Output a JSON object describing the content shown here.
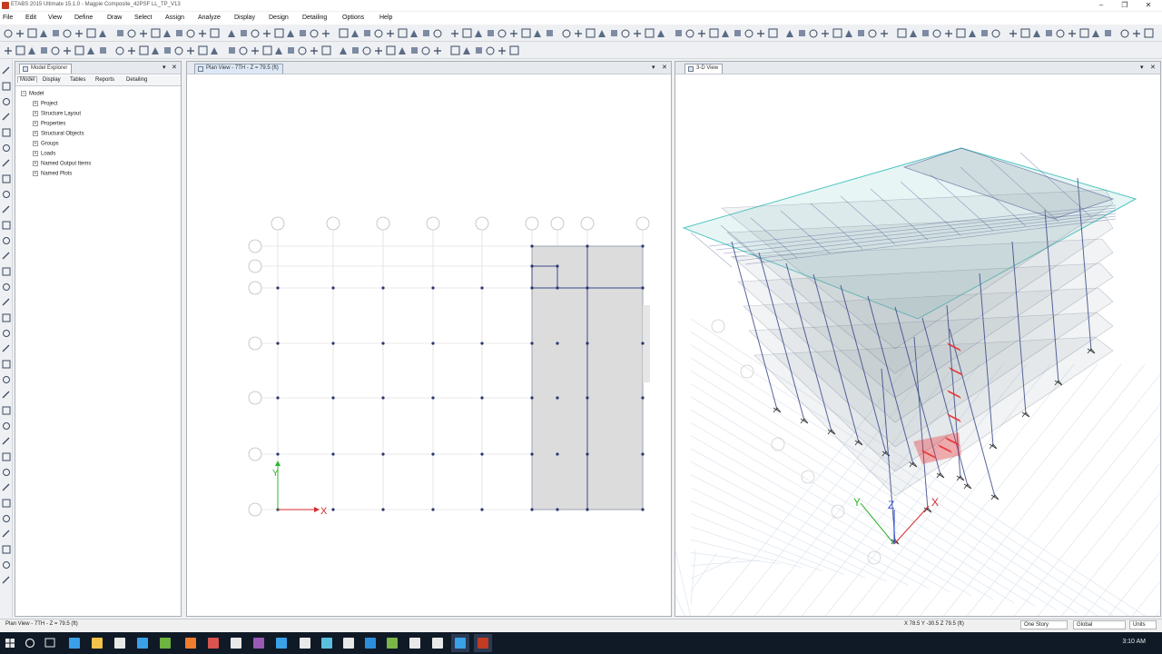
{
  "window": {
    "title": "ETABS 2015 Ultimate 15.1.0 - Magpie Composite_42PSF LL_TP_V13"
  },
  "menu": [
    "File",
    "Edit",
    "View",
    "Define",
    "Draw",
    "Select",
    "Assign",
    "Analyze",
    "Display",
    "Design",
    "Detailing",
    "Options",
    "Help"
  ],
  "model_explorer": {
    "title": "Model Explorer",
    "tabs": [
      "Model",
      "Display",
      "Tables",
      "Reports",
      "Detailing"
    ],
    "active_tab": "Model",
    "root": "Model",
    "items": [
      "Project",
      "Structure Layout",
      "Properties",
      "Structural Objects",
      "Groups",
      "Loads",
      "Named Output Items",
      "Named Plots"
    ]
  },
  "plan_view": {
    "title": "Plan View - 7TH - Z = 79.5 (ft)",
    "axis_x": "X",
    "axis_y": "Y"
  },
  "view3d": {
    "title": "3-D View",
    "axis_x": "X",
    "axis_y": "Y",
    "axis_z": "Z"
  },
  "status": {
    "left": "Plan View - 7TH - Z = 79.5 (ft)",
    "coords": "X 78.5  Y -30.5  Z 79.5 (ft)",
    "story": "One Story",
    "system": "Global",
    "units": "Units"
  },
  "taskbar": {
    "time": "3:10 AM"
  },
  "colors": {
    "grid_bubble": "#bdbdbd",
    "frame": "#3c4a8a",
    "slab": "#9aa4ad",
    "roof_edge": "#4ec6c0",
    "brace": "#e8262b"
  }
}
